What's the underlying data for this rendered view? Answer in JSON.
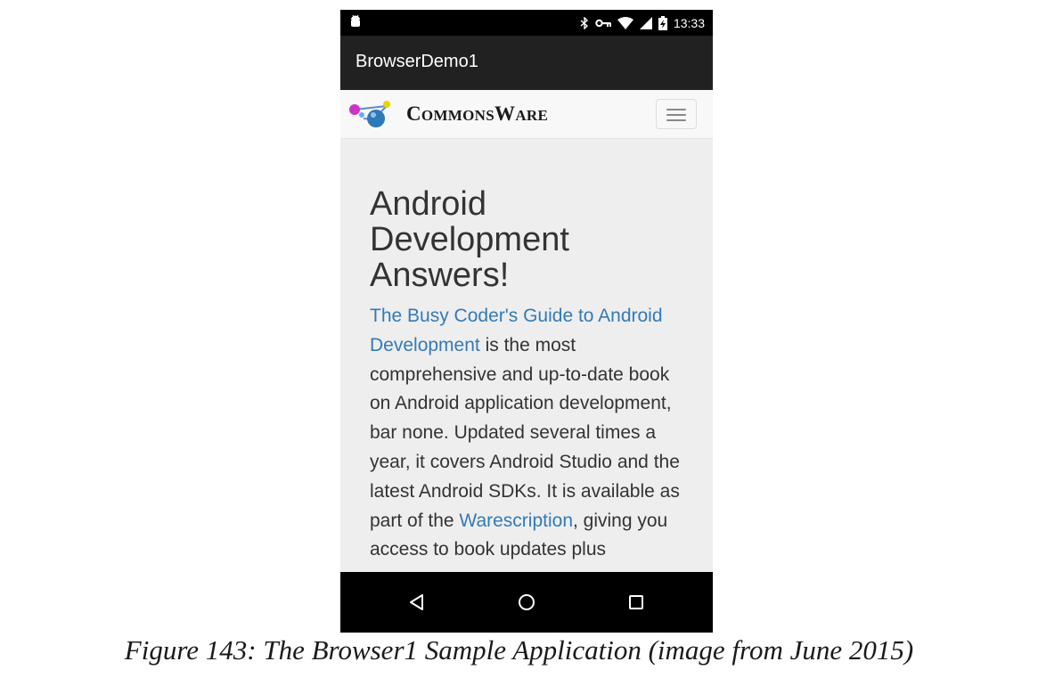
{
  "status_bar": {
    "time": "13:33",
    "icons": [
      "android-debug-icon",
      "bluetooth-icon",
      "vpn-key-icon",
      "wifi-icon",
      "cell-signal-icon",
      "battery-charging-icon"
    ]
  },
  "app": {
    "title": "BrowserDemo1"
  },
  "web": {
    "logo": {
      "prefix_big": "C",
      "prefix_small": "OMMONS",
      "suffix_big": "W",
      "suffix_small": "ARE"
    },
    "headline": "Android Development Answers!",
    "paragraph": {
      "link1": "The Busy Coder's Guide to Android Development",
      "text1": " is the most comprehensive and up-to-date book on Android application development, bar none. Updated several times a year, it covers Android Studio and the latest Android SDKs. It is available as part of the ",
      "link2": "Warescription",
      "text2": ", giving you access to book updates plus"
    },
    "colors": {
      "link": "#337ab7",
      "text": "#333333",
      "background": "#eeeeee"
    }
  },
  "navigation": {
    "back": "back-triangle-icon",
    "home": "home-circle-icon",
    "recents": "recents-square-icon"
  },
  "caption": "Figure 143: The Browser1 Sample Application (image from June 2015)"
}
